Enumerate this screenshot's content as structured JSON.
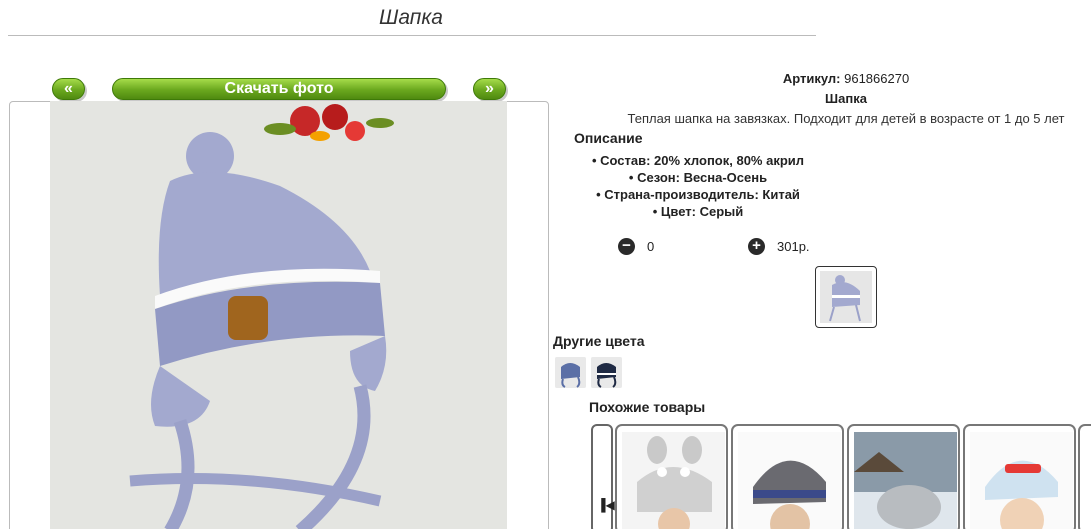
{
  "page": {
    "title": "Шапка"
  },
  "gallery": {
    "prev_label": "«",
    "download_label": "Скачать фото",
    "next_label": "»"
  },
  "product": {
    "sku_label": "Артикул:",
    "sku": "961866270",
    "name": "Шапка",
    "description": "Теплая шапка на завязках. Подходит для детей в возрасте от 1 до 5 лет",
    "desc_heading": "Описание",
    "specs": [
      "Состав: 20% хлопок, 80% акрил",
      "Сезон: Весна-Осень",
      "Страна-производитель: Китай",
      "Цвет: Серый"
    ]
  },
  "cart": {
    "minus_icon": "minus-circle-icon",
    "quantity": "0",
    "plus_icon": "plus-circle-icon",
    "price": "301р."
  },
  "other_colors": {
    "heading": "Другие цвета"
  },
  "similar": {
    "heading": "Похожие товары",
    "prev_icon": "step-back-icon"
  },
  "colors": {
    "accent_green": "#6aa81e",
    "hat": "#a3a9cf"
  }
}
